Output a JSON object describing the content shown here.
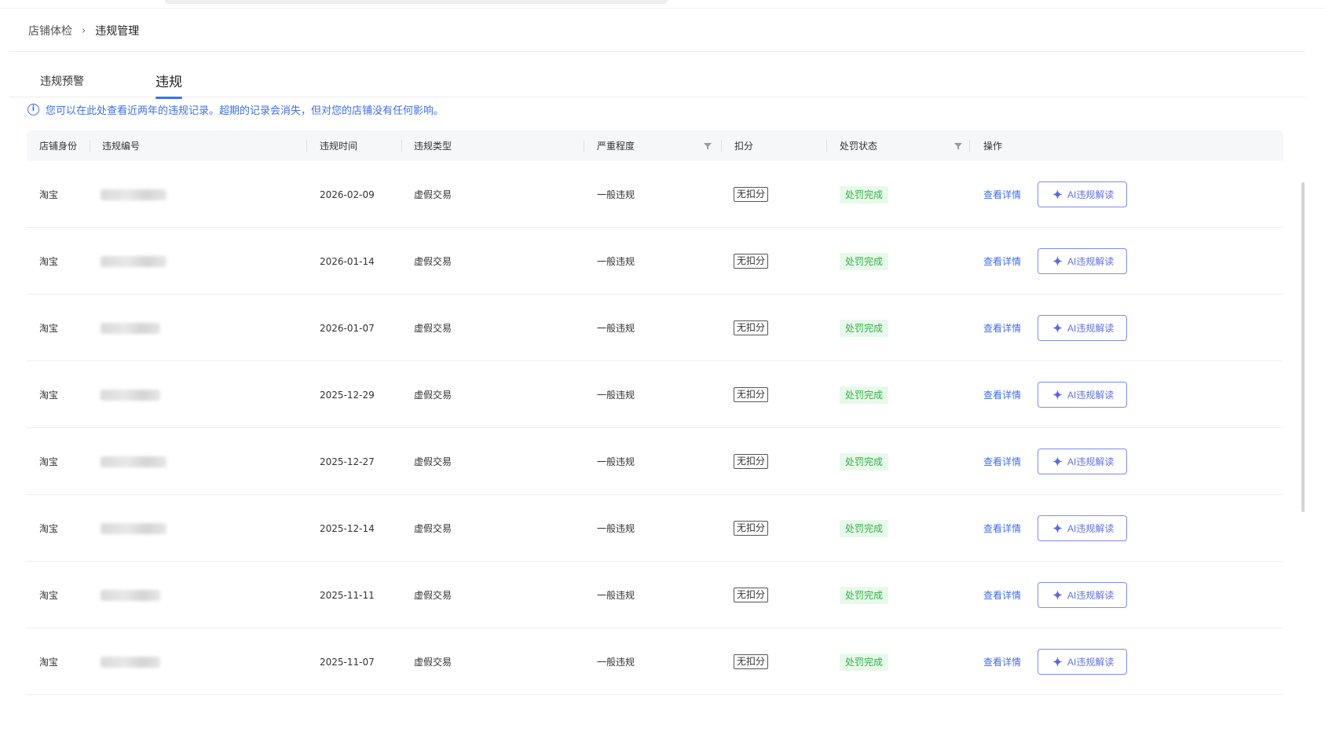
{
  "breadcrumb": {
    "parent": "店铺体检",
    "separator": "›",
    "current": "违规管理"
  },
  "tabs": [
    {
      "label": "违规预警",
      "active": false
    },
    {
      "label": "违规",
      "active": true
    }
  ],
  "notice": {
    "icon": "info-icon",
    "text": "您可以在此处查看近两年的违规记录。超期的记录会消失，但对您的店铺没有任何影响。"
  },
  "table": {
    "columns": [
      "店铺身份",
      "违规编号",
      "违规时间",
      "违规类型",
      "严重程度",
      "扣分",
      "处罚状态",
      "操作"
    ],
    "filterable_columns": [
      "严重程度",
      "处罚状态"
    ],
    "rows": [
      {
        "shop": "淘宝",
        "id": "",
        "date": "2026-02-09",
        "type": "虚假交易",
        "severity": "一般违规",
        "score": "无扣分",
        "status": "处罚完成",
        "detail": "查看详情",
        "ai": "AI违规解读"
      },
      {
        "shop": "淘宝",
        "id": "",
        "date": "2026-01-14",
        "type": "虚假交易",
        "severity": "一般违规",
        "score": "无扣分",
        "status": "处罚完成",
        "detail": "查看详情",
        "ai": "AI违规解读"
      },
      {
        "shop": "淘宝",
        "id": "",
        "date": "2026-01-07",
        "type": "虚假交易",
        "severity": "一般违规",
        "score": "无扣分",
        "status": "处罚完成",
        "detail": "查看详情",
        "ai": "AI违规解读"
      },
      {
        "shop": "淘宝",
        "id": "",
        "date": "2025-12-29",
        "type": "虚假交易",
        "severity": "一般违规",
        "score": "无扣分",
        "status": "处罚完成",
        "detail": "查看详情",
        "ai": "AI违规解读"
      },
      {
        "shop": "淘宝",
        "id": "",
        "date": "2025-12-27",
        "type": "虚假交易",
        "severity": "一般违规",
        "score": "无扣分",
        "status": "处罚完成",
        "detail": "查看详情",
        "ai": "AI违规解读"
      },
      {
        "shop": "淘宝",
        "id": "",
        "date": "2025-12-14",
        "type": "虚假交易",
        "severity": "一般违规",
        "score": "无扣分",
        "status": "处罚完成",
        "detail": "查看详情",
        "ai": "AI违规解读"
      },
      {
        "shop": "淘宝",
        "id": "",
        "date": "2025-11-11",
        "type": "虚假交易",
        "severity": "一般违规",
        "score": "无扣分",
        "status": "处罚完成",
        "detail": "查看详情",
        "ai": "AI违规解读"
      },
      {
        "shop": "淘宝",
        "id": "",
        "date": "2025-11-07",
        "type": "虚假交易",
        "severity": "一般违规",
        "score": "无扣分",
        "status": "处罚完成",
        "detail": "查看详情",
        "ai": "AI违规解读"
      }
    ]
  },
  "colors": {
    "accent": "#3d6ef6",
    "status_bg": "#e8f9ea",
    "status_text": "#2fb345",
    "ai_button": "#6272e8"
  }
}
